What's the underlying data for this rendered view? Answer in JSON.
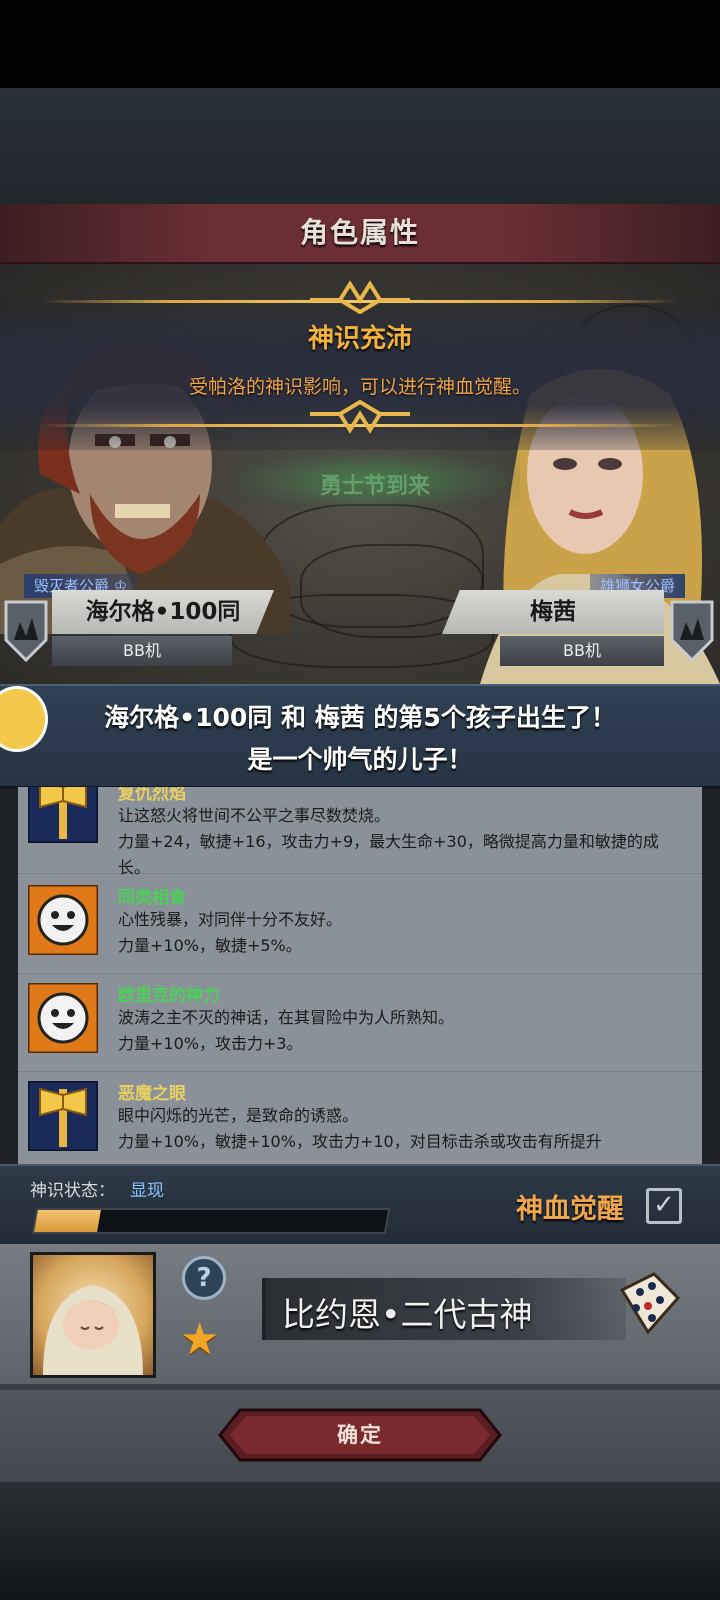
{
  "screen": {
    "title": "角色属性"
  },
  "banner": {
    "title": "神识充沛",
    "description": "受帕洛的神识影响，可以进行神血觉醒。"
  },
  "event": {
    "text": "勇士节到来"
  },
  "father": {
    "title": "毁灭者公爵",
    "name": "海尔格•100同",
    "sub": "BB机"
  },
  "mother": {
    "title": "雄狮女公爵",
    "name": "梅茜",
    "sub": "BB机"
  },
  "announcement": {
    "line1": "海尔格•100同 和 梅茜 的第5个孩子出生了！",
    "line2": "是一个帅气的儿子！"
  },
  "traits": [
    {
      "name": "复仇烈焰",
      "name_color": "#e8d060",
      "icon": "golden-axe-icon",
      "desc1": "让这怒火将世间不公平之事尽数焚烧。",
      "desc2": "力量+24，敏捷+16，攻击力+9，最大生命+30，略微提高力量和敏捷的成长。"
    },
    {
      "name": "同类相食",
      "name_color": "#4cd05a",
      "icon": "smiley-face-icon",
      "desc1": "心性残暴，对同伴十分不友好。",
      "desc2": "力量+10%，敏捷+5%。"
    },
    {
      "name": "欧里克的神力",
      "name_color": "#4cd05a",
      "icon": "smiley-face-icon",
      "desc1": "波涛之主不灭的神话，在其冒险中为人所熟知。",
      "desc2": "力量+10%，攻击力+3。"
    },
    {
      "name": "恶魔之眼",
      "name_color": "#e8d060",
      "icon": "golden-axe-icon",
      "desc1": "眼中闪烁的光芒，是致命的诱惑。",
      "desc2": "力量+10%，敏捷+10%，攻击力+10，对目标击杀或攻击有所提升"
    }
  ],
  "status": {
    "label": "神识状态：",
    "value": "显现",
    "progress": 0.18,
    "awaken_label": "神血觉醒",
    "awaken_checked": true
  },
  "child": {
    "name": "比约恩•二代古神",
    "help_icon": "question-mark-icon",
    "star_icon": "star-icon",
    "dice_icon": "dice-icon"
  },
  "confirm": {
    "label": "确定"
  },
  "colors": {
    "accent_gold": "#f3b23a",
    "awaken_orange": "#f0a64a",
    "status_blue": "#8ec2ff"
  }
}
